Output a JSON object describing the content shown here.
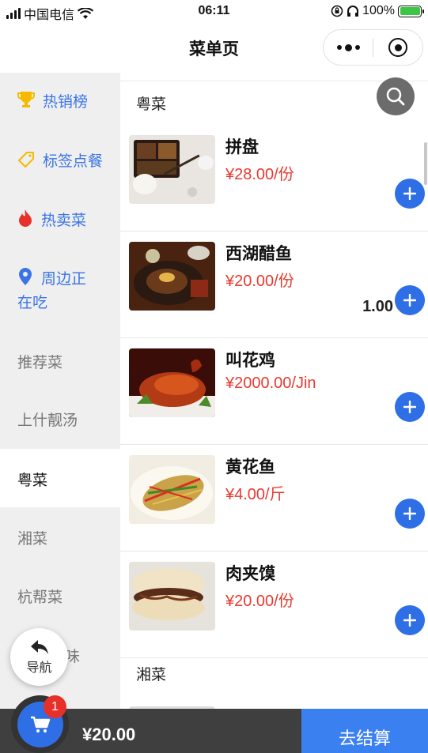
{
  "status_bar": {
    "carrier": "中国电信",
    "time": "06:11",
    "battery_percent": "100%"
  },
  "nav_bar": {
    "title": "菜单页"
  },
  "sidebar": {
    "items": [
      {
        "label": "热销榜",
        "icon": "trophy-icon",
        "highlight": true
      },
      {
        "label": "标签点餐",
        "icon": "tag-icon",
        "highlight": true
      },
      {
        "label": "热卖菜",
        "icon": "flame-icon",
        "highlight": true
      },
      {
        "label": "周边正在吃",
        "line1": "周边正",
        "line2": "在吃",
        "icon": "location-pin-icon",
        "highlight": true
      },
      {
        "label": "推荐菜"
      },
      {
        "label": "上什靓汤"
      },
      {
        "label": "粤菜",
        "active": true
      },
      {
        "label": "湘菜"
      },
      {
        "label": "杭帮菜"
      },
      {
        "label": "味"
      }
    ],
    "float_nav_label": "导航"
  },
  "menu": {
    "sections": [
      {
        "title": "粤菜",
        "dishes": [
          {
            "name": "拼盘",
            "price": "¥28.00/份",
            "quantity": ""
          },
          {
            "name": "西湖醋鱼",
            "price": "¥20.00/份",
            "quantity": "1.00"
          },
          {
            "name": "叫花鸡",
            "price": "¥2000.00/Jin",
            "quantity": ""
          },
          {
            "name": "黄花鱼",
            "price": "¥4.00/斤",
            "quantity": ""
          },
          {
            "name": "肉夹馍",
            "price": "¥20.00/份",
            "quantity": ""
          }
        ]
      },
      {
        "title": "湘菜",
        "dishes": []
      }
    ]
  },
  "cart": {
    "badge_count": "1",
    "total": "¥20.00",
    "checkout_label": "去结算"
  },
  "colors": {
    "accent_blue": "#2f6fe6",
    "price_red": "#e83a30",
    "sidebar_bg": "#efefef",
    "cart_bar_bg": "#3f3f3f",
    "checkout_bg": "#3b80f0"
  }
}
